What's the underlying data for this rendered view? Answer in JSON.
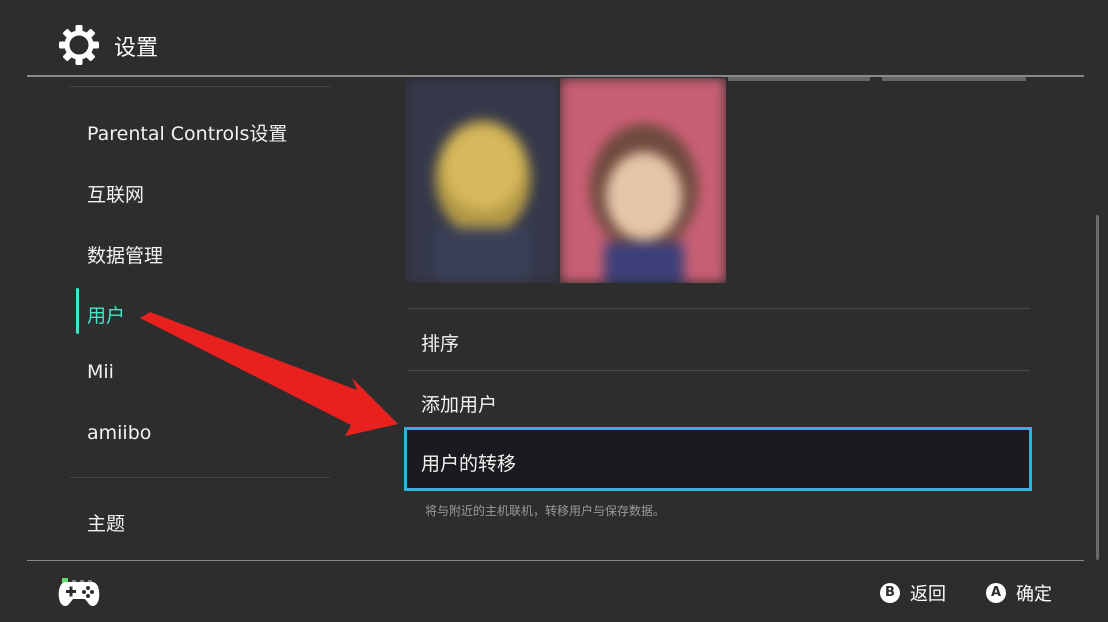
{
  "header": {
    "title": "设置",
    "icon": "gear-icon"
  },
  "sidebar": {
    "items": [
      {
        "label": "Parental Controls设置"
      },
      {
        "label": "互联网"
      },
      {
        "label": "数据管理"
      },
      {
        "label": "用户",
        "active": true
      },
      {
        "label": "Mii"
      },
      {
        "label": "amiibo"
      },
      {
        "label": "主题"
      }
    ]
  },
  "main": {
    "options": [
      {
        "label": "排序"
      },
      {
        "label": "添加用户"
      },
      {
        "label": "用户的转移",
        "selected": true
      }
    ],
    "description": "将与附近的主机联机，转移用户与保存数据。"
  },
  "footer": {
    "back": {
      "key": "B",
      "label": "返回"
    },
    "confirm": {
      "key": "A",
      "label": "确定"
    }
  },
  "colors": {
    "accent": "#3ee8cc",
    "selection": "#2fb2dc",
    "annotation_arrow": "#e8201e"
  }
}
